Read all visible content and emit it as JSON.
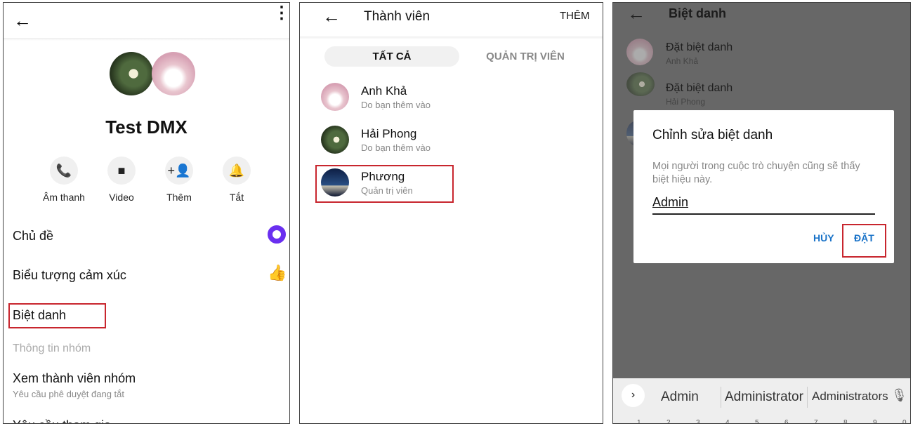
{
  "panel1": {
    "title": "Test DMX",
    "actions": [
      {
        "label": "Âm thanh",
        "icon": "phone-icon"
      },
      {
        "label": "Video",
        "icon": "video-icon"
      },
      {
        "label": "Thêm",
        "icon": "add-person-icon"
      },
      {
        "label": "Tắt",
        "icon": "bell-icon"
      }
    ],
    "menu": {
      "theme": "Chủ đề",
      "emoji": "Biểu tượng cảm xúc",
      "nickname": "Biệt danh",
      "section": "Thông tin nhóm",
      "members": "Xem thành viên nhóm",
      "members_sub": "Yêu cầu phê duyệt đang tắt",
      "join": "Yêu cầu tham gia"
    },
    "colors": {
      "theme": "#6a2ff0",
      "like": "#1877f2",
      "highlight": "#c8262e"
    }
  },
  "panel2": {
    "title": "Thành viên",
    "add": "THÊM",
    "tabs": [
      "TẤT CẢ",
      "QUẢN TRỊ VIÊN"
    ],
    "members": [
      {
        "name": "Anh Khả",
        "sub": "Do bạn thêm vào"
      },
      {
        "name": "Hải Phong",
        "sub": "Do bạn thêm vào"
      },
      {
        "name": "Phương",
        "sub": "Quản trị viên"
      }
    ]
  },
  "panel3": {
    "title": "Biệt danh",
    "rows": [
      {
        "label": "Đặt biệt danh",
        "sub": "Anh Khả"
      },
      {
        "label": "Đặt biệt danh",
        "sub": "Hải Phong"
      }
    ],
    "dialog": {
      "title": "Chỉnh sửa biệt danh",
      "desc": "Mọi người trong cuộc trò chuyện cũng sẽ thấy biệt hiệu này.",
      "value": "Admin",
      "cancel": "HỦY",
      "ok": "ĐẶT"
    },
    "keyboard": {
      "suggestions": [
        "Admin",
        "Administrator",
        "Administrators"
      ],
      "numbers": [
        "1",
        "2",
        "3",
        "4",
        "5",
        "6",
        "7",
        "8",
        "9",
        "0"
      ]
    }
  }
}
